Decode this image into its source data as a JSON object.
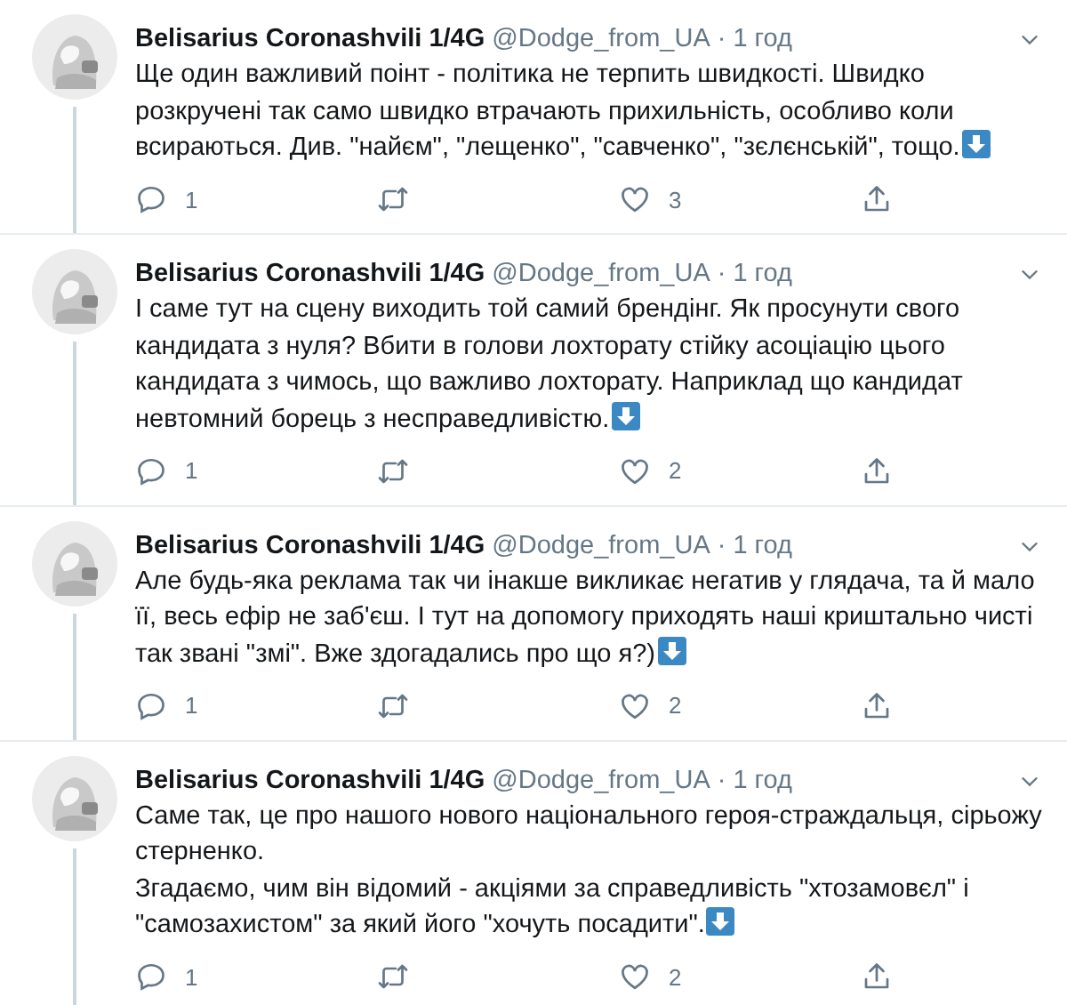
{
  "tweets": [
    {
      "name": "Belisarius Coronashvili 1/4G",
      "handle": "@Dodge_from_UA",
      "separator": "·",
      "time": "1 год",
      "text": "Ще один важливий поінт - політика не терпить швидкості. Швидко розкручені так само швидко втрачають прихильність, особливо коли всираються. Див. \"найєм\", \"лещенко\", \"савченко\", \"зєлєнській\", тощо.",
      "arrow_emoji": true,
      "replies": "1",
      "likes": "3"
    },
    {
      "name": "Belisarius Coronashvili 1/4G",
      "handle": "@Dodge_from_UA",
      "separator": "·",
      "time": "1 год",
      "text": "І саме тут на сцену виходить той самий брендінг. Як просунути свого кандидата з нуля? Вбити в голови лохторату стійку асоціацію цього кандидата з чимось, що важливо лохторату. Наприклад що кандидат невтомний борець з несправедливістю.",
      "arrow_emoji": true,
      "replies": "1",
      "likes": "2"
    },
    {
      "name": "Belisarius Coronashvili 1/4G",
      "handle": "@Dodge_from_UA",
      "separator": "·",
      "time": "1 год",
      "text": "Але будь-яка реклама так чи інакше викликає негатив у глядача, та й мало її, весь ефір не заб'єш. І тут на допомогу приходять наші криштально чисті так звані \"змі\". Вже здогадались про що я?)",
      "arrow_emoji": true,
      "replies": "1",
      "likes": "2"
    },
    {
      "name": "Belisarius Coronashvili 1/4G",
      "handle": "@Dodge_from_UA",
      "separator": "·",
      "time": "1 год",
      "text": "Саме так, це про нашого нового національного героя-страждальця, сірьожу стерненко.\nЗгадаємо, чим він відомий - акціями за справедливість \"хтозамовєл\" і \"самозахистом\" за який його \"хочуть посадити\".",
      "arrow_emoji": true,
      "replies": "1",
      "likes": "2"
    }
  ]
}
